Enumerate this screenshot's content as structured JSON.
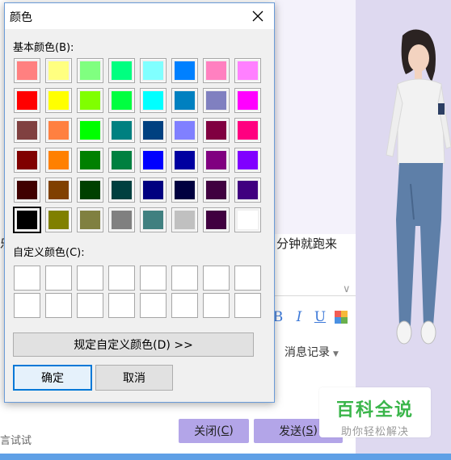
{
  "dialog": {
    "title": "颜色",
    "basic_label": "基本颜色(B):",
    "custom_label": "自定义颜色(C):",
    "define_custom_button": "规定自定义颜色(D) >>",
    "ok_button": "确定",
    "cancel_button": "取消",
    "selected_basic_index": 40,
    "basic_colors": [
      "#ff8080",
      "#ffff80",
      "#80ff80",
      "#00ff80",
      "#80ffff",
      "#0080ff",
      "#ff80c0",
      "#ff80ff",
      "#ff0000",
      "#ffff00",
      "#80ff00",
      "#00ff40",
      "#00ffff",
      "#0080c0",
      "#8080c0",
      "#ff00ff",
      "#804040",
      "#ff8040",
      "#00ff00",
      "#008080",
      "#004080",
      "#8080ff",
      "#800040",
      "#ff0080",
      "#800000",
      "#ff8000",
      "#008000",
      "#008040",
      "#0000ff",
      "#0000a0",
      "#800080",
      "#8000ff",
      "#400000",
      "#804000",
      "#004000",
      "#004040",
      "#000080",
      "#000040",
      "#400040",
      "#400080",
      "#000000",
      "#808000",
      "#808040",
      "#808080",
      "#408080",
      "#c0c0c0",
      "#400040",
      "#ffffff"
    ],
    "custom_colors": [
      "#ffffff",
      "#ffffff",
      "#ffffff",
      "#ffffff",
      "#ffffff",
      "#ffffff",
      "#ffffff",
      "#ffffff",
      "#ffffff",
      "#ffffff",
      "#ffffff",
      "#ffffff",
      "#ffffff",
      "#ffffff",
      "#ffffff",
      "#ffffff"
    ]
  },
  "chat": {
    "fragment_right": "分钟就跑来",
    "fragment_left": "乐",
    "fragment_bottom": "言试试",
    "history_label": "消息记录",
    "close_label": "关闭(C)",
    "close_text": "关闭(",
    "close_key": "C",
    "send_text": "发送(",
    "send_key": "S",
    "paren_close": ")",
    "toolbar": {
      "bold": "B",
      "italic": "I",
      "underline": "U"
    }
  },
  "watermark": {
    "title": "百科全说",
    "subtitle": "助你轻松解决"
  },
  "icons": {
    "close": "close-icon",
    "tiles": "color-tiles-icon",
    "history_arrow": "dropdown-arrow-icon"
  }
}
